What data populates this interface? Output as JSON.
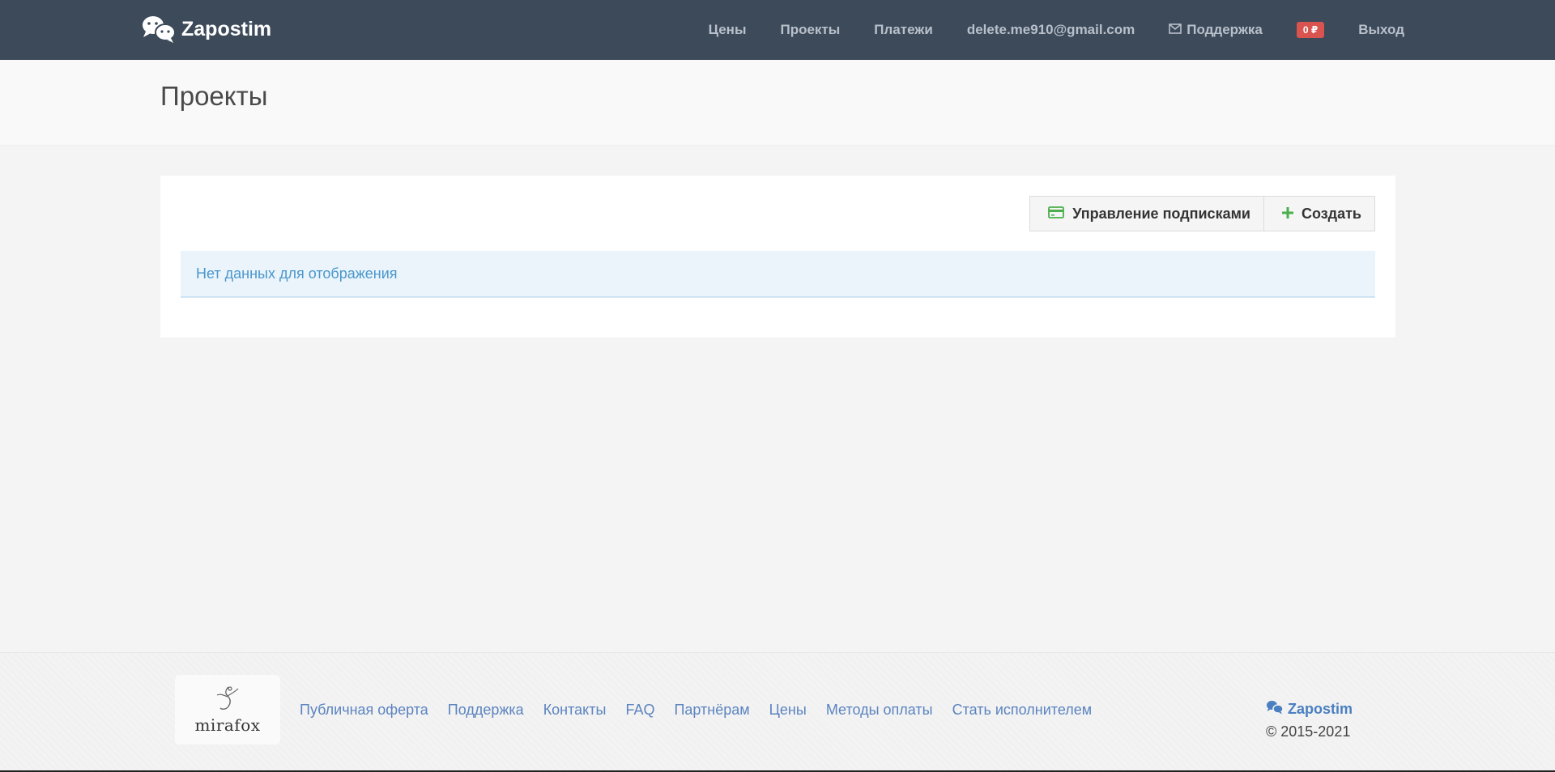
{
  "app": {
    "brand_name": "Zapostim",
    "accent_color": "#3d4a5a"
  },
  "header": {
    "nav": {
      "prices": "Цены",
      "projects": "Проекты",
      "payments": "Платежи",
      "account_email": "delete.me910@gmail.com",
      "support": "Поддержка",
      "balance": "0 ₽",
      "logout": "Выход"
    },
    "icons": {
      "brand": "chat-bubbles-icon",
      "support": "envelope-icon"
    }
  },
  "page": {
    "title": "Проекты"
  },
  "toolbar": {
    "manage_subscriptions_label": "Управление подписками",
    "create_label": "Создать",
    "icons": {
      "manage_subscriptions": "credit-card-icon",
      "create": "plus-icon"
    }
  },
  "projects_list": {
    "empty_message": "Нет данных для отображения"
  },
  "footer": {
    "partner_logo_text": "mirafox",
    "links": [
      "Публичная оферта",
      "Поддержка",
      "Контакты",
      "FAQ",
      "Партнёрам",
      "Цены",
      "Методы оплаты",
      "Стать исполнителем"
    ],
    "brand_name": "Zapostim",
    "copyright": "© 2015-2021"
  }
}
